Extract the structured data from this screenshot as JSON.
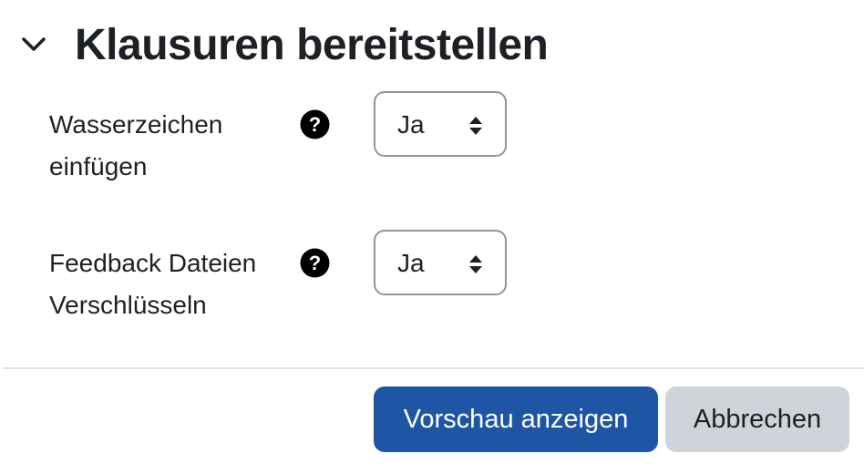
{
  "section": {
    "title": "Klausuren bereitstellen",
    "toggle_icon": "chevron-down-icon"
  },
  "fields": [
    {
      "label": "Wasserzeichen einfügen",
      "help_icon": "question-circle-icon",
      "value": "Ja"
    },
    {
      "label": "Feedback Dateien Verschlüsseln",
      "help_icon": "question-circle-icon",
      "value": "Ja"
    }
  ],
  "buttons": {
    "preview_label": "Vorschau anzeigen",
    "cancel_label": "Abbrechen"
  },
  "colors": {
    "primary": "#1f55a5",
    "secondary": "#ced4da",
    "text": "#1d2125",
    "border": "#8f959e"
  }
}
